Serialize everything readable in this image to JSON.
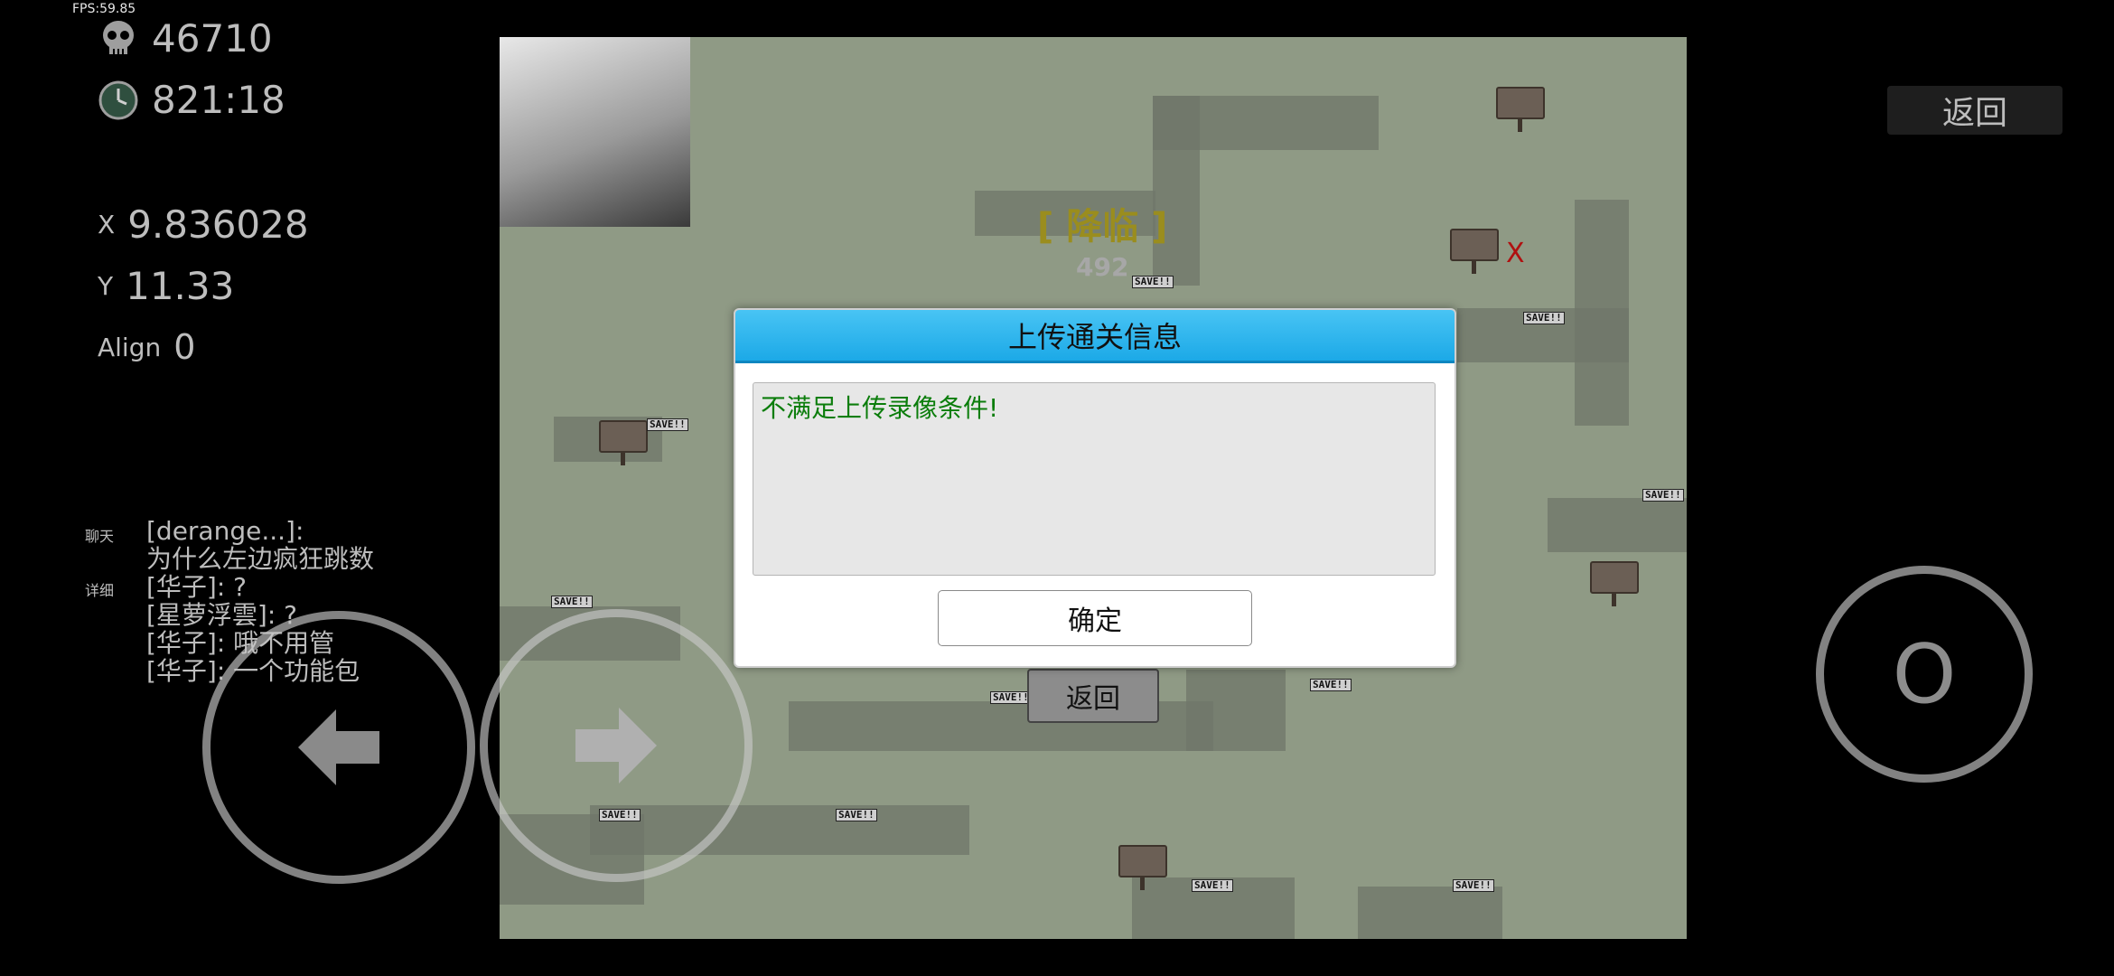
{
  "hud": {
    "fps": "FPS:59.85",
    "deaths": "46710",
    "time": "821:18",
    "x_label": "X",
    "x_value": "9.836028",
    "y_label": "Y",
    "y_value": "11.33",
    "align_label": "Align",
    "align_value": "0"
  },
  "chat": {
    "tab_chat": "聊天",
    "tab_detail": "详细",
    "lines": [
      "[derange...]:",
      "为什么左边疯狂跳数",
      "[华子]: ?",
      "[星萝浮雲]: ?",
      "[华子]: 哦不用管",
      "[华子]: 一个功能包"
    ]
  },
  "game": {
    "title": "[ 降临 ]",
    "counter": "492",
    "save_label": "SAVE!!",
    "x_marker": "X",
    "back_button": "返回"
  },
  "dialog": {
    "title": "上传通关信息",
    "message": "不满足上传录像条件!",
    "confirm": "确定"
  },
  "right": {
    "return_button": "返回",
    "jump_button": "O"
  },
  "icons": {
    "deaths": "skull-icon",
    "time": "clock-icon",
    "left": "arrow-left-icon",
    "right": "arrow-right-icon"
  }
}
